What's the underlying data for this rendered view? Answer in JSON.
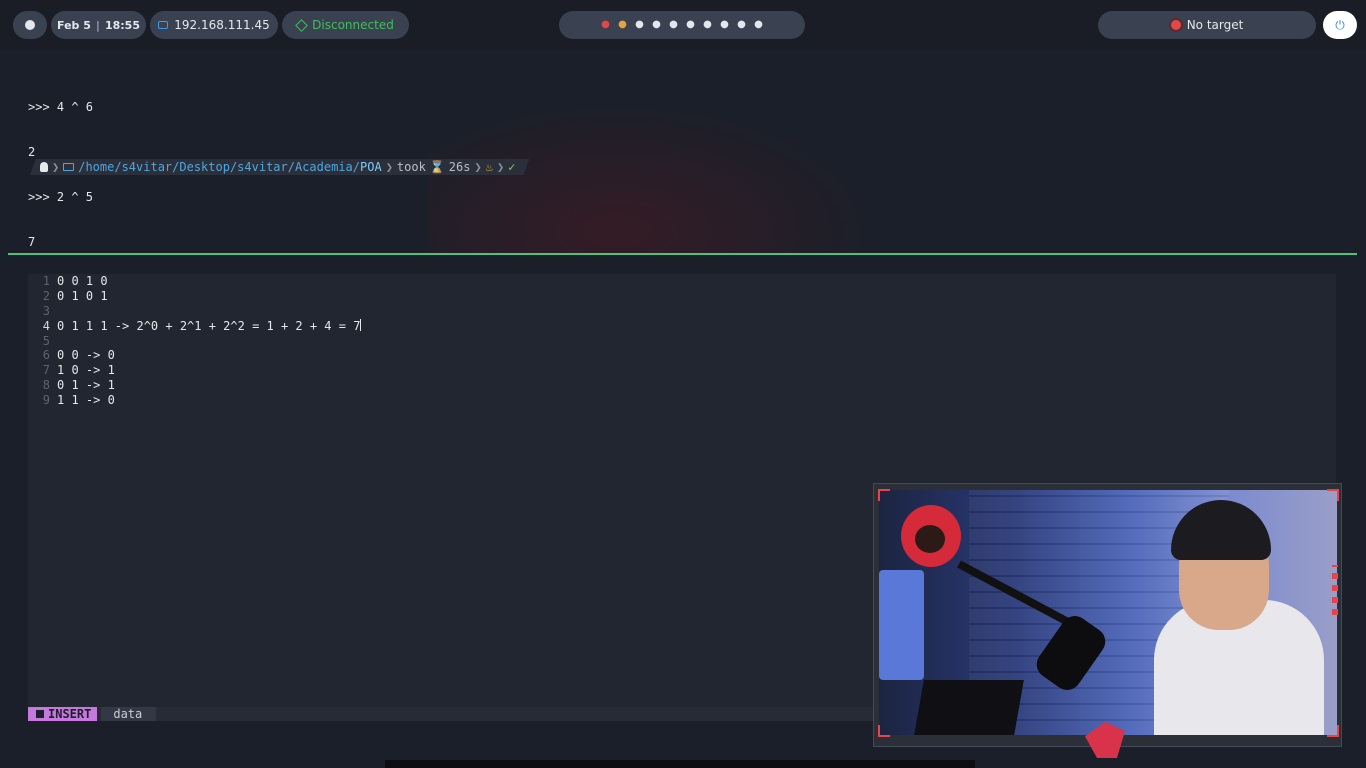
{
  "topbar": {
    "date": "Feb 5",
    "time": "18:55",
    "ip": "192.168.111.45",
    "vpn_status": "Disconnected",
    "target": "No target",
    "icons": [
      "logo-icon",
      "monitor-icon",
      "cube-icon",
      "target-icon",
      "power-icon"
    ]
  },
  "terminal": {
    "repl_lines": [
      ">>> 4 ^ 6",
      "2",
      ">>> 2 ^ 5",
      "7",
      ">>>"
    ],
    "prompt": {
      "path_prefix": "/home/s4vitar/Desktop/s4vitar/Academia/",
      "path_last": "POA",
      "took_label": "took",
      "duration": "26s",
      "check": "✓"
    }
  },
  "editor": {
    "lines": [
      {
        "num": "1",
        "text": "0 0 1 0"
      },
      {
        "num": "2",
        "text": "0 1 0 1"
      },
      {
        "num": "3",
        "text": ""
      },
      {
        "num": "4",
        "text": "0 1 1 1 -> 2^0 + 2^1 + 2^2 = 1 + 2 + 4 = 7"
      },
      {
        "num": "5",
        "text": ""
      },
      {
        "num": "6",
        "text": "0 0 -> 0"
      },
      {
        "num": "7",
        "text": "1 0 -> 1"
      },
      {
        "num": "8",
        "text": "0 1 -> 1"
      },
      {
        "num": "9",
        "text": "1 1 -> 0"
      }
    ],
    "current_line": 4,
    "mode": "INSERT",
    "filename": "data"
  },
  "colors": {
    "accent_green": "#4ec27a",
    "mode_purple": "#c678dd",
    "path_blue": "#4fa6e0",
    "vpn_green": "#3fbf5a",
    "cam_red": "#e8424a"
  }
}
